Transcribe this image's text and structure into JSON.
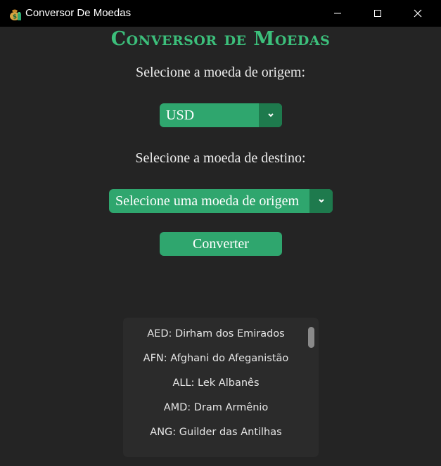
{
  "window": {
    "title": "Conversor De Moedas",
    "icons": {
      "app": "money-bag-icon",
      "minimize": "minimize-icon",
      "maximize": "maximize-icon",
      "close": "close-icon"
    }
  },
  "main": {
    "heading": "Conversor de Moedas",
    "origin_label": "Selecione a moeda de origem:",
    "origin_value": "USD",
    "destination_label": "Selecione a moeda de destino:",
    "destination_value": "Selecione uma moeda de origem",
    "convert_label": "Converter"
  },
  "currency_list": {
    "items": [
      "AED: Dirham dos Emirados",
      "AFN: Afghani do Afeganistão",
      "ALL: Lek Albanês",
      "AMD: Dram Armênio",
      "ANG: Guilder das Antilhas"
    ]
  },
  "colors": {
    "accent": "#2fa66e",
    "accent_dark": "#1e7a4d",
    "heading": "#3cbf7b",
    "background": "#242424",
    "titlebar": "#000000"
  }
}
